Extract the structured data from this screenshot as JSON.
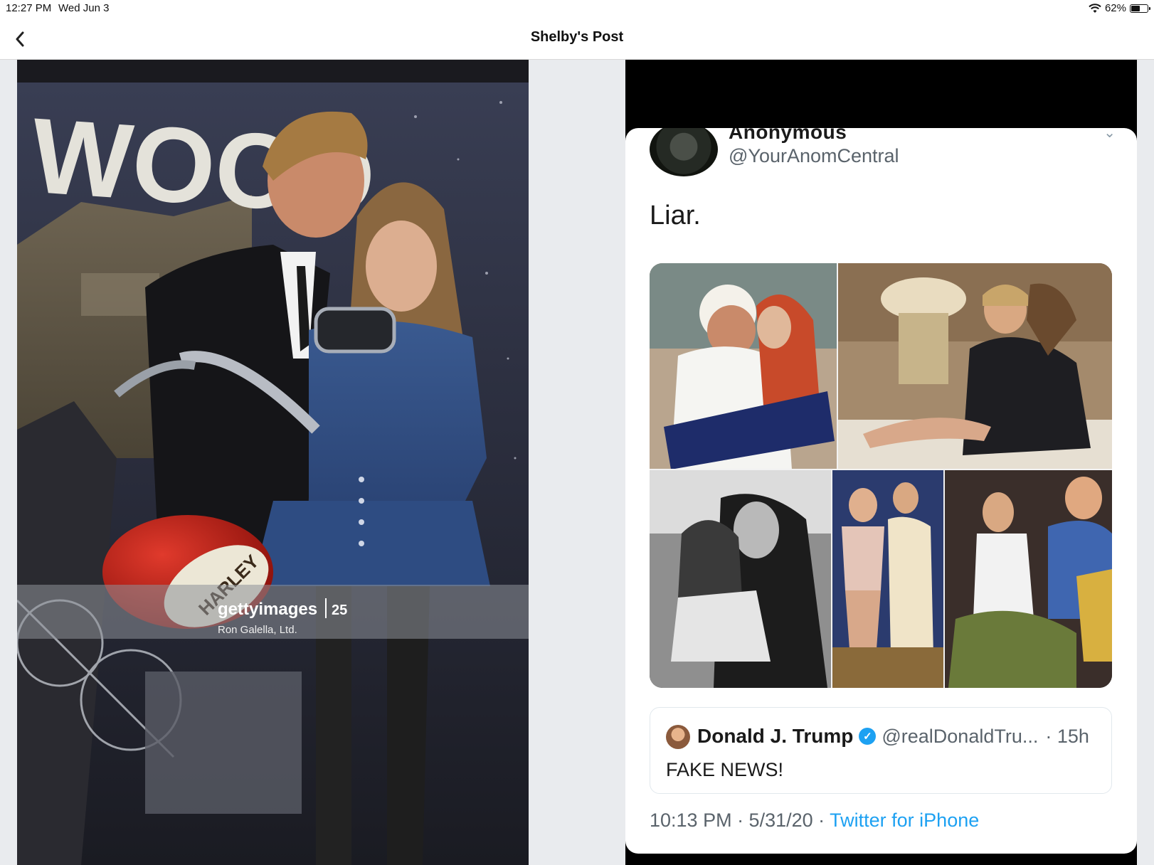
{
  "status_bar": {
    "time": "12:27 PM",
    "date": "Wed Jun 3",
    "battery_percent": "62%",
    "battery_level": 0.62
  },
  "nav": {
    "title": "Shelby's Post",
    "back_icon": "chevron-left-icon"
  },
  "left_photo": {
    "sign_text": "WOOD",
    "tank_text": "HARLEY",
    "watermark_brand": "gettyimages",
    "watermark_badge": "25",
    "watermark_credit": "Ron Galella, Ltd."
  },
  "tweet": {
    "author_name": "Anonymous",
    "author_handle": "@YourAnomCentral",
    "text": "Liar.",
    "quoted": {
      "name": "Donald J. Trump",
      "handle": "@realDonaldTru...",
      "time": "· 15h",
      "text": "FAKE NEWS!"
    },
    "timestamp": "10:13 PM · 5/31/20 ·",
    "source": "Twitter for iPhone"
  },
  "colors": {
    "twitter_blue": "#1da1f2",
    "canvas_bg": "#e9ebee"
  }
}
